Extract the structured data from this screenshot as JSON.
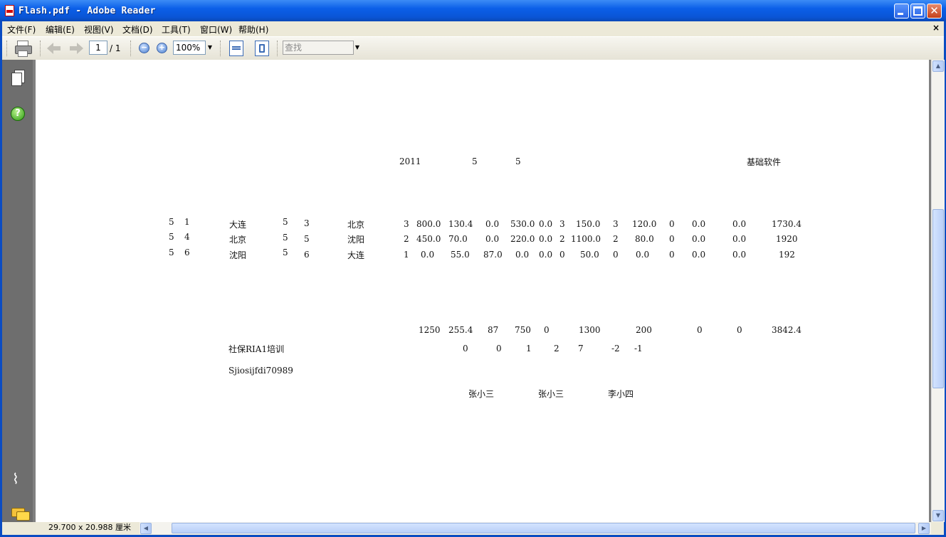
{
  "window": {
    "title": "Flash.pdf - Adobe Reader",
    "close_glyph": "✕"
  },
  "menu": [
    "文件(F)",
    "编辑(E)",
    "视图(V)",
    "文档(D)",
    "工具(T)",
    "窗口(W)",
    "帮助(H)"
  ],
  "menu_close": "×",
  "toolbar": {
    "page_current": "1",
    "page_total": "/ 1",
    "zoom": "100%",
    "search_placeholder": "查找",
    "zoom_out": "−",
    "zoom_in": "+"
  },
  "icons": [
    "printer-icon",
    "prev-page-icon",
    "next-page-icon",
    "zoom-out-icon",
    "zoom-in-icon",
    "fit-width-icon",
    "fit-page-icon",
    "pages-icon",
    "help-icon",
    "attachment-icon",
    "comments-icon"
  ],
  "status": {
    "dimensions": "29.700 x 20.988 厘米"
  },
  "document": {
    "header": {
      "year": "2011",
      "month": "5",
      "day": "5",
      "company": "基础软件"
    },
    "rows": [
      {
        "c1": "5",
        "c2": "1",
        "from": "大连",
        "c4": "5",
        "c5": "3",
        "to": "北京",
        "n1": "3",
        "v1": "800.0",
        "v2": "130.4",
        "v3": "0.0",
        "v4": "530.0",
        "v5": "0.0",
        "n2": "3",
        "v6": "150.0",
        "n3": "3",
        "v7": "120.0",
        "n4": "0",
        "v8": "0.0",
        "v9": "0.0",
        "total": "1730.4"
      },
      {
        "c1": "5",
        "c2": "4",
        "from": "北京",
        "c4": "5",
        "c5": "5",
        "to": "沈阳",
        "n1": "2",
        "v1": "450.0",
        "v2": "70.0",
        "v3": "0.0",
        "v4": "220.0",
        "v5": "0.0",
        "n2": "2",
        "v6": "1100.0",
        "n3": "2",
        "v7": "80.0",
        "n4": "0",
        "v8": "0.0",
        "v9": "0.0",
        "total": "1920"
      },
      {
        "c1": "5",
        "c2": "6",
        "from": "沈阳",
        "c4": "5",
        "c5": "6",
        "to": "大连",
        "n1": "1",
        "v1": "0.0",
        "v2": "55.0",
        "v3": "87.0",
        "v4": "0.0",
        "v5": "0.0",
        "n2": "0",
        "v6": "50.0",
        "n3": "0",
        "v7": "0.0",
        "n4": "0",
        "v8": "0.0",
        "v9": "0.0",
        "total": "192"
      }
    ],
    "totals": [
      "1250",
      "255.4",
      "87",
      "750",
      "0",
      "1300",
      "200",
      "0",
      "0",
      "3842.4"
    ],
    "project": {
      "label": "社保RIA1培训",
      "values": [
        "0",
        "0",
        "1",
        "2",
        "7",
        "-2",
        "-1"
      ]
    },
    "code": "Sjiosijfdi70989",
    "signers": [
      "张小三",
      "张小三",
      "李小四"
    ]
  }
}
